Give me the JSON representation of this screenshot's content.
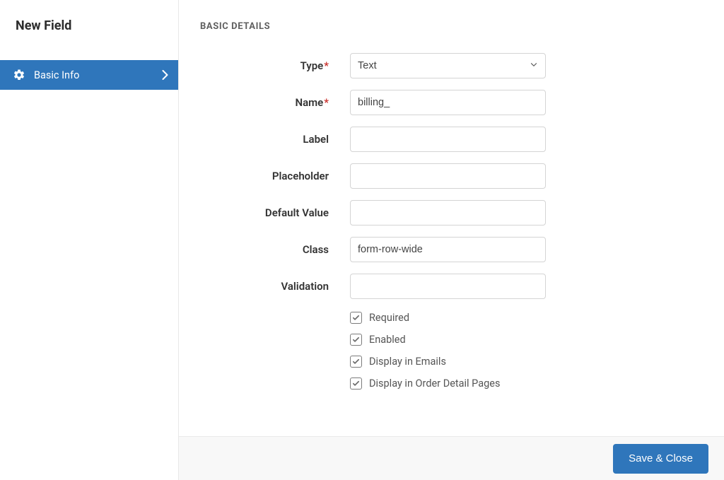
{
  "sidebar": {
    "title": "New Field",
    "items": [
      {
        "label": "Basic Info"
      }
    ]
  },
  "section_title": "BASIC DETAILS",
  "form": {
    "type": {
      "label": "Type",
      "required": true,
      "value": "Text"
    },
    "name": {
      "label": "Name",
      "required": true,
      "value": "billing_"
    },
    "label_field": {
      "label": "Label",
      "value": ""
    },
    "placeholder": {
      "label": "Placeholder",
      "value": ""
    },
    "default_value": {
      "label": "Default Value",
      "value": ""
    },
    "class_field": {
      "label": "Class",
      "value": "form-row-wide"
    },
    "validation": {
      "label": "Validation",
      "value": ""
    }
  },
  "checkboxes": {
    "required": {
      "label": "Required",
      "checked": true
    },
    "enabled": {
      "label": "Enabled",
      "checked": true
    },
    "display_emails": {
      "label": "Display in Emails",
      "checked": true
    },
    "display_order_detail": {
      "label": "Display in Order Detail Pages",
      "checked": true
    }
  },
  "footer": {
    "save_label": "Save & Close"
  }
}
